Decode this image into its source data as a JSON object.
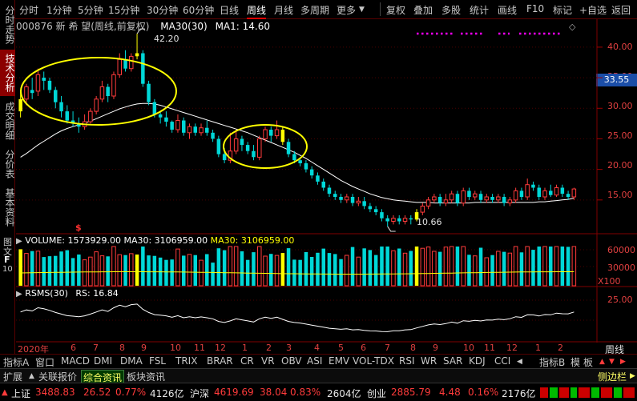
{
  "toolbar": {
    "periods": [
      "分时",
      "1分钟",
      "5分钟",
      "15分钟",
      "30分钟",
      "60分钟",
      "日线",
      "周线",
      "月线",
      "多周期",
      "更多"
    ],
    "active_period": "周线",
    "more_icon": "triangle-down-icon",
    "actions": [
      "复权",
      "叠加",
      "多股",
      "统计",
      "画线",
      "F10",
      "标记",
      "+自选",
      "返回"
    ]
  },
  "sidetabs": [
    "分时走势",
    "技术分析",
    "成交明细",
    "分价表",
    "基本资料"
  ],
  "sidetabs_active": "技术分析",
  "side_lower": [
    "图",
    "文",
    "F",
    "10"
  ],
  "info": {
    "stock": "000876 新 希 望(周线,前复权)",
    "ma30_label": "MA30(30)",
    "ma1": "MA1: 14.60",
    "high_mark": "42.20",
    "low_mark": "10.66",
    "price_tag": "33.55"
  },
  "price_axis": [
    "40.00",
    "35.00",
    "30.00",
    "25.00",
    "20.00",
    "15.00"
  ],
  "volume": {
    "label": "VOLUME: 1573929.00",
    "ma30": "MA30: 3106959.00",
    "ma30b": "MA30: 3106959.00",
    "axis": [
      "60000",
      "30000",
      "X100"
    ]
  },
  "rsms": {
    "label": "RSMS(30)",
    "rs": "RS: 16.84",
    "axis": [
      "25.00"
    ]
  },
  "dates": [
    "2020年",
    "6",
    "7",
    "8",
    "9",
    "10",
    "11",
    "12",
    "1",
    "2",
    "3",
    "4",
    "5",
    "6",
    "7",
    "8",
    "9",
    "10",
    "11",
    "12",
    "1",
    "2"
  ],
  "date_right": "周线",
  "indicators": [
    "指标A",
    "窗口",
    "MACD",
    "DMI",
    "DMA",
    "FSL",
    "TRIX",
    "BRAR",
    "CR",
    "VR",
    "OBV",
    "ASI",
    "EMV",
    "VOL-TDX",
    "RSI",
    "WR",
    "SAR",
    "KDJ",
    "CCI"
  ],
  "indicators_right": [
    "指标B",
    "模",
    "板"
  ],
  "subtabs": [
    "扩展",
    "关联报价",
    "综合资讯",
    "板块资讯"
  ],
  "subtab_selected": "综合资讯",
  "sidebar_toggle": "侧边栏",
  "status": {
    "sh_name": "上证",
    "sh_val": "3488.83",
    "sh_chg": "26.52",
    "sh_pct": "0.77%",
    "sh_amt": "4126亿",
    "sz_name": "沪深",
    "sz_val": "4619.69",
    "sz_chg": "38.04",
    "sz_pct": "0.83%",
    "sz_amt": "2604亿",
    "cy_name": "创业",
    "cy_val": "2885.79",
    "cy_chg": "4.48",
    "cy_pct": "0.16%",
    "cy_amt": "2176亿"
  },
  "chart_data": {
    "type": "candlestick",
    "period": "weekly",
    "price_axis_range": [
      10,
      43
    ],
    "candles": [
      {
        "o": 29.5,
        "c": 31.5,
        "h": 33.0,
        "l": 28.5
      },
      {
        "o": 31.5,
        "c": 33.5,
        "h": 34.0,
        "l": 30.5
      },
      {
        "o": 33.0,
        "c": 32.5,
        "h": 35.0,
        "l": 31.5
      },
      {
        "o": 32.8,
        "c": 35.5,
        "h": 36.5,
        "l": 32.0
      },
      {
        "o": 35.0,
        "c": 34.5,
        "h": 36.0,
        "l": 33.0
      },
      {
        "o": 34.5,
        "c": 33.0,
        "h": 35.0,
        "l": 32.5
      },
      {
        "o": 33.0,
        "c": 31.0,
        "h": 33.5,
        "l": 30.0
      },
      {
        "o": 31.0,
        "c": 29.5,
        "h": 32.0,
        "l": 28.5
      },
      {
        "o": 29.5,
        "c": 28.0,
        "h": 30.5,
        "l": 27.5
      },
      {
        "o": 28.0,
        "c": 27.5,
        "h": 29.5,
        "l": 27.0
      },
      {
        "o": 27.5,
        "c": 27.0,
        "h": 28.5,
        "l": 26.0
      },
      {
        "o": 27.0,
        "c": 27.8,
        "h": 29.0,
        "l": 26.5
      },
      {
        "o": 27.8,
        "c": 29.5,
        "h": 30.0,
        "l": 27.5
      },
      {
        "o": 29.5,
        "c": 31.5,
        "h": 32.0,
        "l": 29.0
      },
      {
        "o": 31.5,
        "c": 33.5,
        "h": 34.5,
        "l": 31.0
      },
      {
        "o": 33.5,
        "c": 32.0,
        "h": 34.0,
        "l": 31.0
      },
      {
        "o": 32.0,
        "c": 35.5,
        "h": 36.0,
        "l": 31.5
      },
      {
        "o": 35.5,
        "c": 38.0,
        "h": 39.0,
        "l": 35.0
      },
      {
        "o": 38.0,
        "c": 36.5,
        "h": 39.5,
        "l": 36.0
      },
      {
        "o": 36.5,
        "c": 38.5,
        "h": 39.0,
        "l": 36.0
      },
      {
        "o": 38.5,
        "c": 39.0,
        "h": 42.2,
        "l": 38.0
      },
      {
        "o": 39.0,
        "c": 34.0,
        "h": 39.5,
        "l": 33.5
      },
      {
        "o": 34.0,
        "c": 31.0,
        "h": 34.5,
        "l": 30.5
      },
      {
        "o": 31.0,
        "c": 29.0,
        "h": 31.5,
        "l": 28.5
      },
      {
        "o": 29.0,
        "c": 28.5,
        "h": 29.5,
        "l": 27.5
      },
      {
        "o": 28.5,
        "c": 27.8,
        "h": 29.5,
        "l": 27.0
      },
      {
        "o": 27.8,
        "c": 26.5,
        "h": 28.0,
        "l": 26.0
      },
      {
        "o": 26.5,
        "c": 28.0,
        "h": 29.0,
        "l": 26.0
      },
      {
        "o": 28.0,
        "c": 26.0,
        "h": 28.5,
        "l": 25.5
      },
      {
        "o": 26.0,
        "c": 27.0,
        "h": 27.5,
        "l": 25.0
      },
      {
        "o": 27.0,
        "c": 26.0,
        "h": 27.5,
        "l": 25.5
      },
      {
        "o": 26.0,
        "c": 26.8,
        "h": 27.5,
        "l": 25.5
      },
      {
        "o": 26.8,
        "c": 26.0,
        "h": 28.0,
        "l": 25.5
      },
      {
        "o": 26.0,
        "c": 25.0,
        "h": 26.5,
        "l": 24.5
      },
      {
        "o": 25.0,
        "c": 22.5,
        "h": 25.5,
        "l": 22.0
      },
      {
        "o": 22.5,
        "c": 21.5,
        "h": 23.5,
        "l": 21.0
      },
      {
        "o": 21.5,
        "c": 23.0,
        "h": 26.0,
        "l": 21.0
      },
      {
        "o": 23.0,
        "c": 25.0,
        "h": 26.5,
        "l": 22.5
      },
      {
        "o": 25.0,
        "c": 24.0,
        "h": 25.5,
        "l": 23.0
      },
      {
        "o": 24.0,
        "c": 23.0,
        "h": 24.5,
        "l": 22.5
      },
      {
        "o": 23.0,
        "c": 22.0,
        "h": 24.0,
        "l": 21.5
      },
      {
        "o": 22.0,
        "c": 25.0,
        "h": 25.5,
        "l": 21.5
      },
      {
        "o": 25.0,
        "c": 26.5,
        "h": 27.0,
        "l": 24.5
      },
      {
        "o": 26.5,
        "c": 25.5,
        "h": 27.0,
        "l": 24.5
      },
      {
        "o": 25.5,
        "c": 26.5,
        "h": 28.0,
        "l": 25.0
      },
      {
        "o": 26.5,
        "c": 24.5,
        "h": 27.0,
        "l": 24.0
      },
      {
        "o": 24.5,
        "c": 22.5,
        "h": 25.0,
        "l": 22.0
      },
      {
        "o": 22.5,
        "c": 21.5,
        "h": 23.0,
        "l": 21.0
      },
      {
        "o": 21.5,
        "c": 21.0,
        "h": 22.0,
        "l": 20.5
      },
      {
        "o": 21.0,
        "c": 20.0,
        "h": 21.5,
        "l": 19.5
      },
      {
        "o": 20.0,
        "c": 19.0,
        "h": 20.5,
        "l": 18.5
      },
      {
        "o": 19.0,
        "c": 18.0,
        "h": 19.5,
        "l": 17.5
      },
      {
        "o": 18.0,
        "c": 17.0,
        "h": 18.5,
        "l": 16.5
      },
      {
        "o": 17.0,
        "c": 16.0,
        "h": 17.5,
        "l": 15.5
      },
      {
        "o": 16.0,
        "c": 15.5,
        "h": 16.5,
        "l": 15.0
      },
      {
        "o": 15.5,
        "c": 15.0,
        "h": 16.0,
        "l": 14.5
      },
      {
        "o": 15.0,
        "c": 15.5,
        "h": 16.0,
        "l": 14.5
      },
      {
        "o": 15.5,
        "c": 14.5,
        "h": 16.0,
        "l": 14.0
      },
      {
        "o": 14.5,
        "c": 14.8,
        "h": 15.5,
        "l": 14.0
      },
      {
        "o": 14.8,
        "c": 14.0,
        "h": 15.5,
        "l": 13.5
      },
      {
        "o": 14.0,
        "c": 13.5,
        "h": 14.5,
        "l": 13.0
      },
      {
        "o": 13.5,
        "c": 13.0,
        "h": 14.0,
        "l": 12.5
      },
      {
        "o": 13.0,
        "c": 12.0,
        "h": 13.5,
        "l": 11.5
      },
      {
        "o": 12.0,
        "c": 11.5,
        "h": 12.5,
        "l": 10.66
      },
      {
        "o": 11.5,
        "c": 12.0,
        "h": 12.5,
        "l": 11.0
      },
      {
        "o": 12.0,
        "c": 11.5,
        "h": 12.5,
        "l": 11.0
      },
      {
        "o": 11.5,
        "c": 12.0,
        "h": 12.5,
        "l": 11.0
      },
      {
        "o": 12.0,
        "c": 11.8,
        "h": 12.5,
        "l": 11.0
      },
      {
        "o": 11.8,
        "c": 13.0,
        "h": 13.5,
        "l": 11.5
      },
      {
        "o": 13.0,
        "c": 14.0,
        "h": 14.5,
        "l": 12.5
      },
      {
        "o": 14.0,
        "c": 15.0,
        "h": 15.5,
        "l": 13.5
      },
      {
        "o": 15.0,
        "c": 15.5,
        "h": 16.0,
        "l": 14.5
      },
      {
        "o": 15.5,
        "c": 14.5,
        "h": 16.0,
        "l": 14.0
      },
      {
        "o": 14.5,
        "c": 15.0,
        "h": 16.0,
        "l": 14.0
      },
      {
        "o": 15.0,
        "c": 16.0,
        "h": 16.5,
        "l": 14.5
      },
      {
        "o": 16.0,
        "c": 14.5,
        "h": 16.5,
        "l": 14.0
      },
      {
        "o": 14.5,
        "c": 16.5,
        "h": 17.0,
        "l": 14.0
      },
      {
        "o": 16.5,
        "c": 15.5,
        "h": 17.0,
        "l": 15.0
      },
      {
        "o": 15.5,
        "c": 16.0,
        "h": 16.5,
        "l": 15.0
      },
      {
        "o": 16.0,
        "c": 15.0,
        "h": 16.5,
        "l": 14.5
      },
      {
        "o": 15.0,
        "c": 15.5,
        "h": 16.0,
        "l": 14.5
      },
      {
        "o": 15.5,
        "c": 15.0,
        "h": 16.0,
        "l": 14.5
      },
      {
        "o": 15.0,
        "c": 15.5,
        "h": 16.0,
        "l": 14.5
      },
      {
        "o": 15.5,
        "c": 14.5,
        "h": 16.0,
        "l": 14.0
      },
      {
        "o": 14.5,
        "c": 15.0,
        "h": 15.5,
        "l": 14.0
      },
      {
        "o": 15.0,
        "c": 16.5,
        "h": 17.0,
        "l": 14.5
      },
      {
        "o": 16.5,
        "c": 15.5,
        "h": 17.0,
        "l": 15.0
      },
      {
        "o": 15.5,
        "c": 17.5,
        "h": 18.5,
        "l": 15.0
      },
      {
        "o": 17.5,
        "c": 17.0,
        "h": 18.0,
        "l": 16.5
      },
      {
        "o": 17.0,
        "c": 15.5,
        "h": 17.5,
        "l": 15.0
      },
      {
        "o": 15.5,
        "c": 16.5,
        "h": 17.0,
        "l": 15.0
      },
      {
        "o": 16.5,
        "c": 15.8,
        "h": 17.5,
        "l": 15.5
      },
      {
        "o": 15.8,
        "c": 17.0,
        "h": 17.5,
        "l": 15.5
      },
      {
        "o": 17.0,
        "c": 16.0,
        "h": 17.5,
        "l": 15.5
      },
      {
        "o": 16.0,
        "c": 15.5,
        "h": 16.5,
        "l": 15.0
      },
      {
        "o": 15.5,
        "c": 16.8,
        "h": 17.0,
        "l": 15.0
      }
    ],
    "ma30": [
      22.0,
      22.6,
      23.3,
      24.0,
      24.6,
      25.2,
      25.8,
      26.3,
      26.7,
      27.0,
      27.3,
      27.6,
      27.9,
      28.3,
      28.7,
      29.1,
      29.5,
      29.9,
      30.2,
      30.5,
      30.7,
      30.8,
      30.8,
      30.7,
      30.5,
      30.2,
      29.9,
      29.6,
      29.3,
      29.0,
      28.7,
      28.4,
      28.1,
      27.8,
      27.5,
      27.2,
      26.9,
      26.6,
      26.3,
      26.0,
      25.6,
      25.2,
      24.8,
      24.4,
      24.0,
      23.6,
      23.2,
      22.8,
      22.3,
      21.8,
      21.2,
      20.6,
      20.0,
      19.4,
      18.8,
      18.2,
      17.7,
      17.2,
      16.8,
      16.4,
      16.0,
      15.7,
      15.4,
      15.2,
      15.0,
      14.9,
      14.8,
      14.7,
      14.6,
      14.6,
      14.6,
      14.5,
      14.5,
      14.5,
      14.5,
      14.5,
      14.5,
      14.5,
      14.6,
      14.6,
      14.6,
      14.6,
      14.6,
      14.6,
      14.6,
      14.6,
      14.6,
      14.6,
      14.6,
      14.7,
      14.7,
      14.8,
      14.9,
      15.0,
      15.1,
      15.3
    ]
  }
}
